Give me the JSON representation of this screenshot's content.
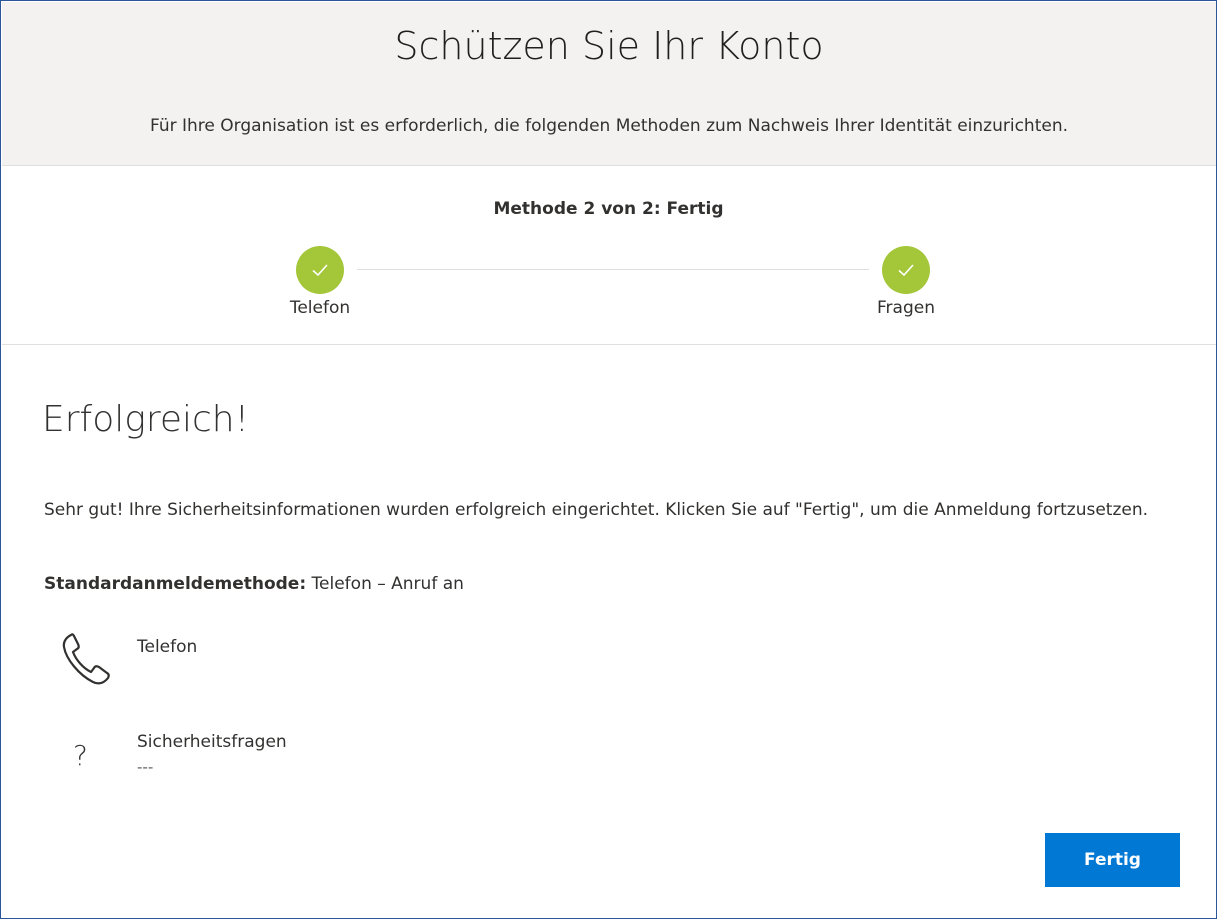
{
  "header": {
    "title": "Schützen Sie Ihr Konto",
    "subtitle": "Für Ihre Organisation ist es erforderlich, die folgenden Methoden zum Nachweis Ihrer Identität einzurichten."
  },
  "progress": {
    "label": "Methode 2 von 2: Fertig",
    "steps": [
      {
        "label": "Telefon",
        "status": "complete",
        "icon": "checkmark-icon"
      },
      {
        "label": "Fragen",
        "status": "complete",
        "icon": "checkmark-icon"
      }
    ],
    "accent_color": "#a4c639"
  },
  "content": {
    "title": "Erfolgreich!",
    "text": "Sehr gut! Ihre Sicherheitsinformationen wurden erfolgreich eingerichtet. Klicken Sie auf \"Fertig\", um die Anmeldung fortzusetzen.",
    "default_method_label": "Standardanmeldemethode:",
    "default_method_value": "Telefon – Anruf an",
    "methods": [
      {
        "name": "Telefon",
        "detail": "",
        "icon": "phone-icon"
      },
      {
        "name": "Sicherheitsfragen",
        "detail": "---",
        "icon": "question-icon"
      }
    ]
  },
  "actions": {
    "done_label": "Fertig",
    "done_color": "#0078d4"
  }
}
